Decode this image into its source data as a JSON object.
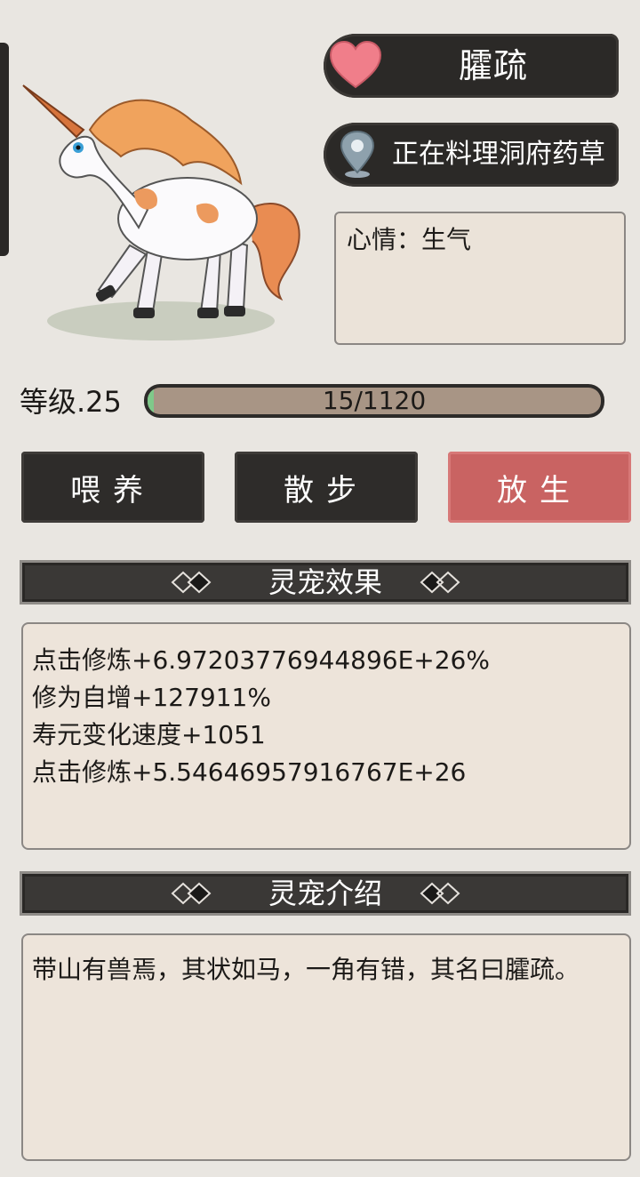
{
  "pet": {
    "name": "臛疏",
    "status": "正在料理洞府药草",
    "mood": "心情：生气"
  },
  "level": {
    "label": "等级.25",
    "exp_text": "15/1120",
    "exp_current": 15,
    "exp_max": 1120
  },
  "actions": {
    "feed": "喂养",
    "walk": "散步",
    "release": "放生"
  },
  "effects": {
    "title": "灵宠效果",
    "lines": [
      "点击修炼+6.97203776944896E+26%",
      "修为自增+127911%",
      "寿元变化速度+1051",
      "点击修炼+5.54646957916767E+26"
    ]
  },
  "intro": {
    "title": "灵宠介绍",
    "text": "带山有兽焉，其状如马，一角有错，其名曰臛疏。"
  },
  "colors": {
    "heart": "#f07e8a",
    "release_button": "#c96362",
    "exp_fill": "#7fc98a"
  },
  "icons": {
    "name_badge": "heart-icon",
    "status_badge": "location-pin-icon"
  }
}
